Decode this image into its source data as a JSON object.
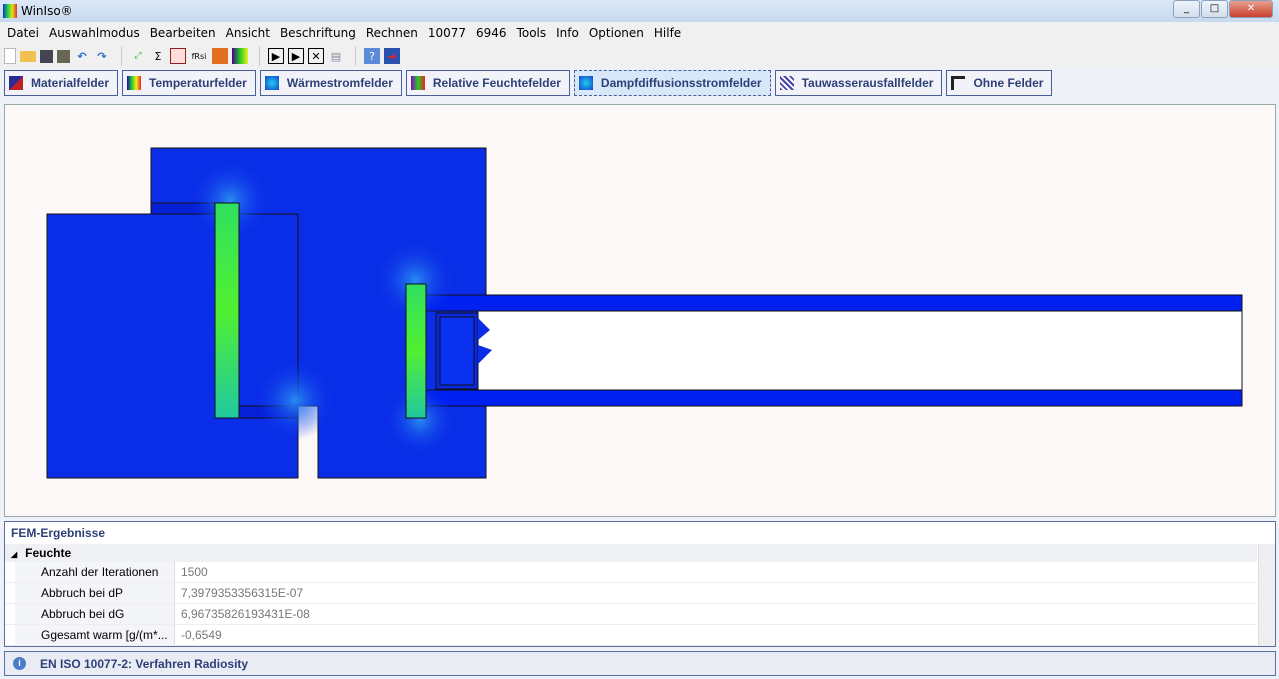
{
  "window": {
    "title": "WinIso®"
  },
  "menu": [
    "Datei",
    "Auswahlmodus",
    "Bearbeiten",
    "Ansicht",
    "Beschriftung",
    "Rechnen",
    "10077",
    "6946",
    "Tools",
    "Info",
    "Optionen",
    "Hilfe"
  ],
  "toolbar": {
    "sum": "Σ",
    "frsi": "fRsi"
  },
  "tabs": [
    {
      "label": "Materialfelder"
    },
    {
      "label": "Temperaturfelder"
    },
    {
      "label": "Wärmestromfelder"
    },
    {
      "label": "Relative Feuchtefelder"
    },
    {
      "label": "Dampfdiffusionsstromfelder",
      "active": true
    },
    {
      "label": "Tauwasserausfallfelder"
    },
    {
      "label": "Ohne Felder"
    }
  ],
  "results": {
    "title": "FEM-Ergebnisse",
    "group": "Feuchte",
    "rows": [
      {
        "k": "Anzahl der Iterationen",
        "v": "1500"
      },
      {
        "k": "Abbruch bei dP",
        "v": "7,3979353356315E-07"
      },
      {
        "k": "Abbruch bei dG",
        "v": "6,96735826193431E-08"
      },
      {
        "k": "Ggesamt warm [g/(m*...",
        "v": "-0,6549"
      }
    ]
  },
  "status": {
    "text": "EN ISO 10077-2: Verfahren Radiosity"
  },
  "colors": {
    "field": "#0a2ee8",
    "accent": "#2c3f78"
  }
}
